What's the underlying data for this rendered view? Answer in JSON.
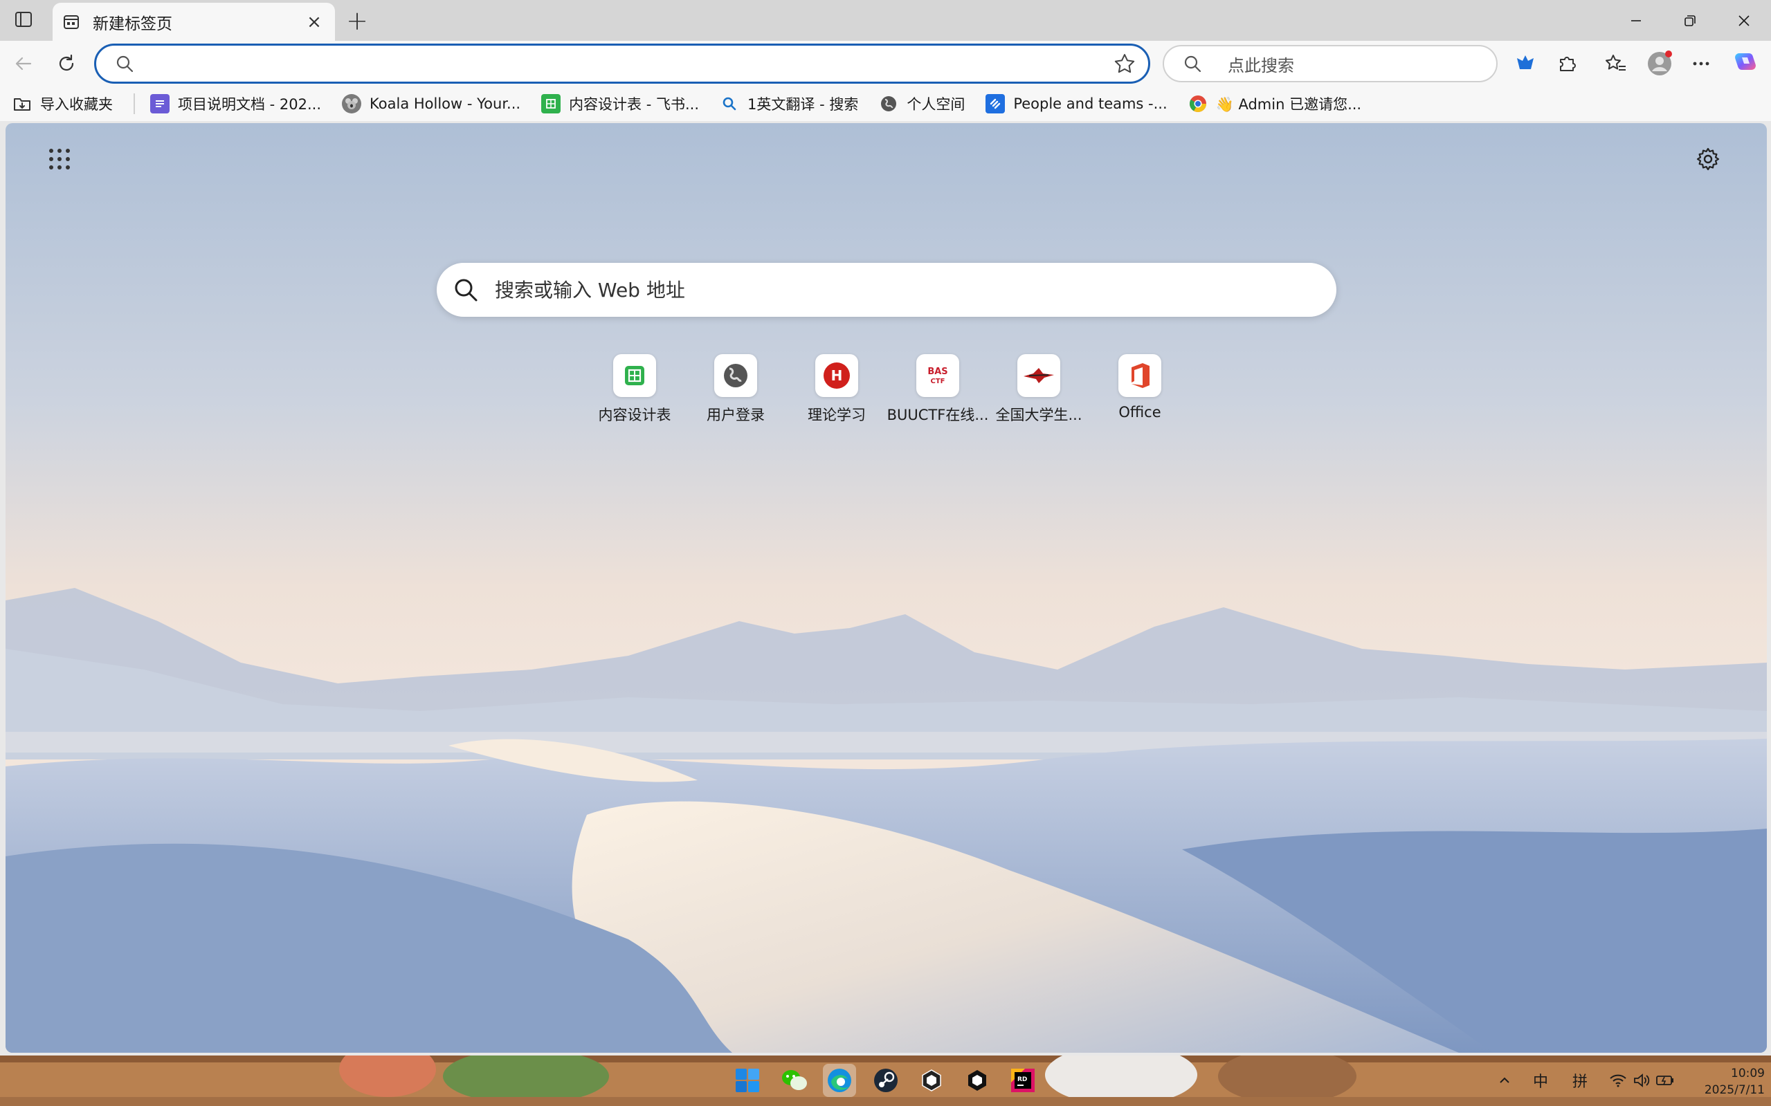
{
  "tab": {
    "title": "新建标签页",
    "close": "×"
  },
  "new_tab_symbol": "+",
  "omnibox": {
    "value": "",
    "placeholder": ""
  },
  "side_search": {
    "placeholder": "点此搜索"
  },
  "bookmarks": [
    {
      "label": "导入收藏夹",
      "icon": "import-folder-icon"
    },
    {
      "label": "项目说明文档 - 202...",
      "icon": "doc-icon",
      "color": "#6b5bd6"
    },
    {
      "label": "Koala Hollow - Your...",
      "icon": "koala-icon",
      "color": "#7a7a7a"
    },
    {
      "label": "内容设计表 - 飞书...",
      "icon": "sheet-icon",
      "color": "#2fb14d"
    },
    {
      "label": "1英文翻译 - 搜索",
      "icon": "search-icon",
      "color": "#1a73c8"
    },
    {
      "label": "个人空间",
      "icon": "globe-icon",
      "color": "#555555"
    },
    {
      "label": "People and teams -...",
      "icon": "jira-icon",
      "color": "#1f6fe0"
    },
    {
      "label": "👋 Admin 已邀请您...",
      "icon": "chrome-icon",
      "color": "#e24a3a"
    }
  ],
  "main_search": {
    "placeholder": "搜索或输入 Web 地址"
  },
  "quick_links": [
    {
      "label": "内容设计表",
      "icon": "sheet-icon",
      "color": "#2fb14d"
    },
    {
      "label": "用户登录",
      "icon": "globe-icon",
      "color": "#555555"
    },
    {
      "label": "理论学习",
      "icon": "h-icon",
      "color": "#d0201c",
      "glyph": "H"
    },
    {
      "label": "BUUCTF在线...",
      "icon": "bas-icon",
      "color": "#c81e2c",
      "glyph": "BAS"
    },
    {
      "label": "全国大学生...",
      "icon": "bird-icon",
      "color": "#b81c1c"
    },
    {
      "label": "Office",
      "icon": "office-icon",
      "color": "#e0452b"
    }
  ],
  "taskbar": {
    "tray_lang": "中",
    "tray_ime": "拼",
    "time": "10:09",
    "date": "2025/7/11"
  },
  "colors": {
    "accent": "#1a5fb4",
    "sky_top": "#aebfd6",
    "sky_mid": "#f1e4d8",
    "dune": "#8aa1c6"
  }
}
